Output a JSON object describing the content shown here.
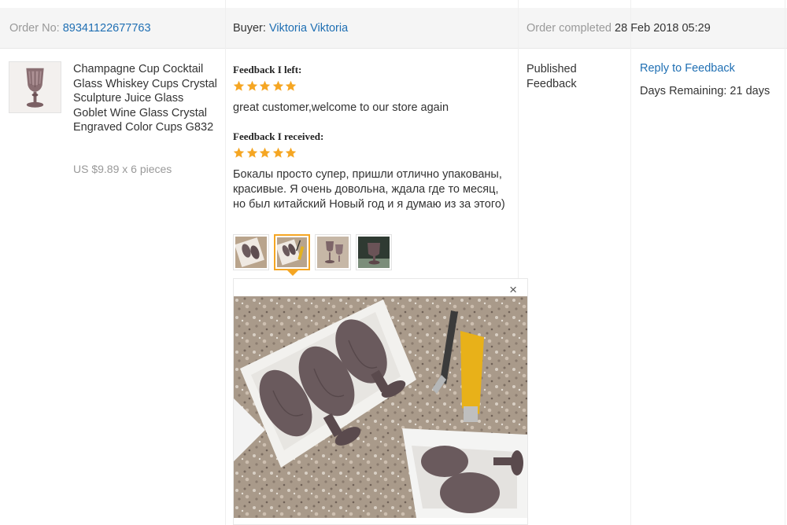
{
  "order": {
    "order_no_label": "Order No:",
    "order_no": "89341122677763",
    "buyer_label": "Buyer:",
    "buyer_name": "Viktoria Viktoria",
    "completed_label": "Order completed",
    "completed_date": "28 Feb 2018 05:29"
  },
  "product": {
    "title": "Champagne Cup Cocktail Glass Whiskey Cups Crystal Sculpture Juice Glass Goblet Wine Glass Crystal Engraved Color Cups G832",
    "price": "US $9.89 x 6 pieces",
    "image_icon": "goblet-image"
  },
  "feedback": {
    "left_label": "Feedback I left:",
    "left_rating": 5,
    "left_text": "great customer,welcome to our store again",
    "received_label": "Feedback I received:",
    "received_rating": 5,
    "received_text": "Бокалы просто супер, пришли отлично упакованы, красивые. Я очень довольна, ждала где то месяц, но был китайский Новый год и я думаю из за этого)",
    "photo_count": 4,
    "selected_photo": 2,
    "close_label": "×"
  },
  "status": {
    "text": "Published Feedback"
  },
  "actions": {
    "reply_label": "Reply to Feedback",
    "days_remaining": "Days Remaining: 21 days"
  },
  "colors": {
    "link": "#1f6fb3",
    "star": "#f5a623",
    "muted": "#999999",
    "header_bg": "#f5f5f5"
  }
}
